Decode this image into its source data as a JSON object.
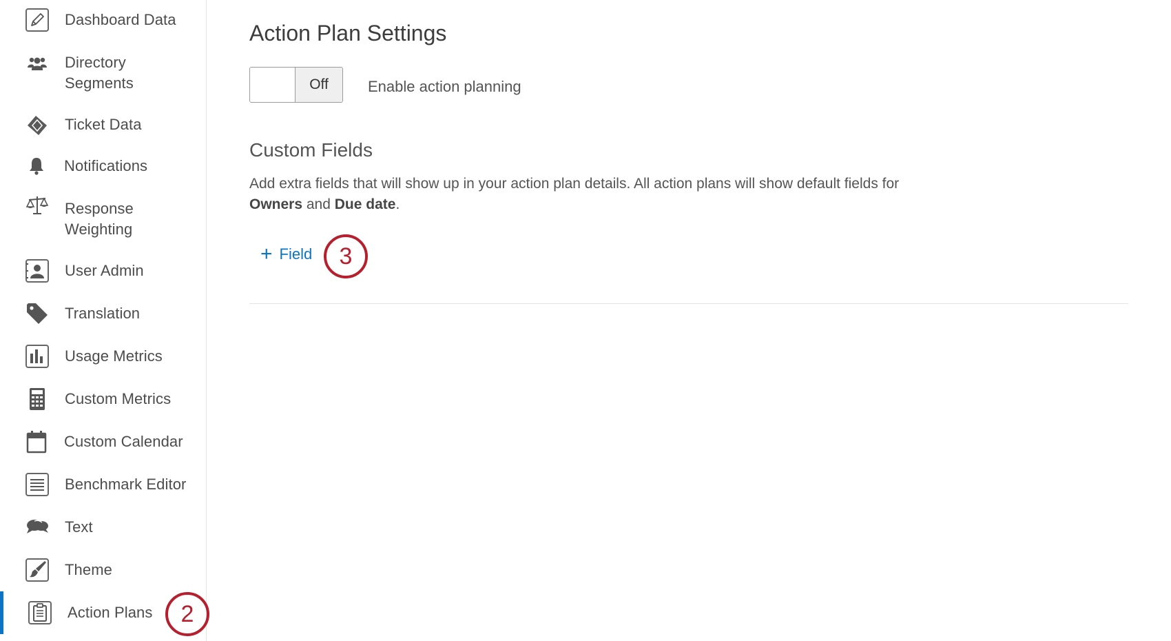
{
  "sidebar": {
    "items": [
      {
        "label": "Dashboard Data",
        "icon": "pencil-edit-icon"
      },
      {
        "label": "Directory\nSegments",
        "icon": "users-group-icon"
      },
      {
        "label": "Ticket Data",
        "icon": "ticket-icon"
      },
      {
        "label": "Notifications",
        "icon": "bell-icon"
      },
      {
        "label": "Response\nWeighting",
        "icon": "scale-icon"
      },
      {
        "label": "User Admin",
        "icon": "user-card-icon"
      },
      {
        "label": "Translation",
        "icon": "tag-icon"
      },
      {
        "label": "Usage Metrics",
        "icon": "bar-chart-icon"
      },
      {
        "label": "Custom Metrics",
        "icon": "calculator-icon"
      },
      {
        "label": "Custom Calendar",
        "icon": "calendar-icon"
      },
      {
        "label": "Benchmark Editor",
        "icon": "list-lines-icon"
      },
      {
        "label": "Text",
        "icon": "speech-bubbles-icon"
      },
      {
        "label": "Theme",
        "icon": "paintbrush-icon"
      },
      {
        "label": "Action Plans",
        "icon": "clipboard-icon",
        "active": true
      }
    ]
  },
  "main": {
    "title": "Action Plan Settings",
    "toggle": {
      "state": "Off",
      "label": "Enable action planning"
    },
    "custom_fields": {
      "title": "Custom Fields",
      "description_prefix": "Add extra fields that will show up in your action plan details. All action plans will show default fields for",
      "owners": "Owners",
      "and": "and",
      "due_date": "Due date",
      "period": ".",
      "add_field_label": "Field",
      "add_field_icon": "plus-icon"
    }
  },
  "callouts": {
    "step2": "2",
    "step3": "3"
  },
  "colors": {
    "accent": "#0b74c4",
    "callout": "#b51f2e",
    "text": "#545454"
  }
}
